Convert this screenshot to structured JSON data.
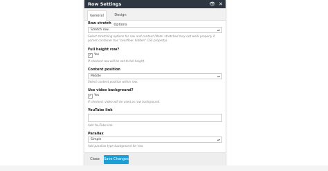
{
  "window": {
    "title": "Row Settings",
    "icons": [
      "eye-icon",
      "close-icon"
    ]
  },
  "tabs": [
    {
      "label": "General",
      "active": true
    },
    {
      "label": "Design Options",
      "active": false
    }
  ],
  "fields": {
    "row_stretch": {
      "label": "Row stretch",
      "value": "Stretch row",
      "hint": "Select stretching options for row and content (Note: stretched may not work properly if parent container has \"overflow: hidden\" CSS property)."
    },
    "full_height": {
      "label": "Full height row?",
      "checkbox_label": "Yes",
      "checked": true,
      "hint": "If checked row will be set to full height."
    },
    "content_position": {
      "label": "Content position",
      "value": "Middle",
      "hint": "Select content position within row."
    },
    "video_bg": {
      "label": "Use video background?",
      "checkbox_label": "Yes",
      "checked": true,
      "hint": "If checked, video will be used as row background."
    },
    "youtube_link": {
      "label": "YouTube link",
      "value": "",
      "hint": "Add YouTube link."
    },
    "parallax": {
      "label": "Parallax",
      "value": "Simple",
      "hint": "Add parallax type background for row."
    }
  },
  "footer": {
    "close_label": "Close",
    "save_label": "Save Changes"
  },
  "colors": {
    "titlebar": "#2e3642",
    "save_button": "#1aa0d6"
  }
}
